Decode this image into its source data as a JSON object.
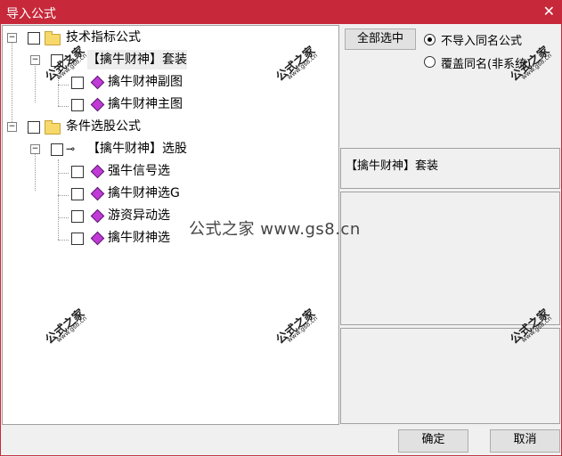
{
  "window": {
    "title": "导入公式",
    "close_glyph": "✕"
  },
  "tree": {
    "groups": [
      {
        "label": "技术指标公式",
        "expander": "−",
        "suite": {
          "label": "【擒牛财神】套装",
          "expander": "−",
          "items": [
            "擒牛财神副图",
            "擒牛财神主图"
          ]
        }
      },
      {
        "label": "条件选股公式",
        "expander": "−",
        "suite": {
          "label": "【擒牛财神】选股",
          "expander": "−",
          "items": [
            "强牛信号选",
            "擒牛财神选G",
            "游资异动选",
            "擒牛财神选"
          ]
        }
      }
    ]
  },
  "options": {
    "select_all": "全部选中",
    "radio_skip": "不导入同名公式",
    "radio_overwrite": "覆盖同名(非系统)",
    "selected_value": "skip"
  },
  "selected_item": "【擒牛财神】套装",
  "buttons": {
    "ok": "确定",
    "cancel": "取消"
  },
  "watermark": {
    "text": "公式之家",
    "url": "www.gs8.cn",
    "center": "公式之家 www.gs8.cn"
  },
  "icons": {
    "group": "folder-icon",
    "suite": "key-icon",
    "formula": "formula-diamond-icon"
  },
  "colors": {
    "titlebar": "#c7283a",
    "formula_icon": "#c03ad6",
    "folder": "#f7d86a"
  }
}
